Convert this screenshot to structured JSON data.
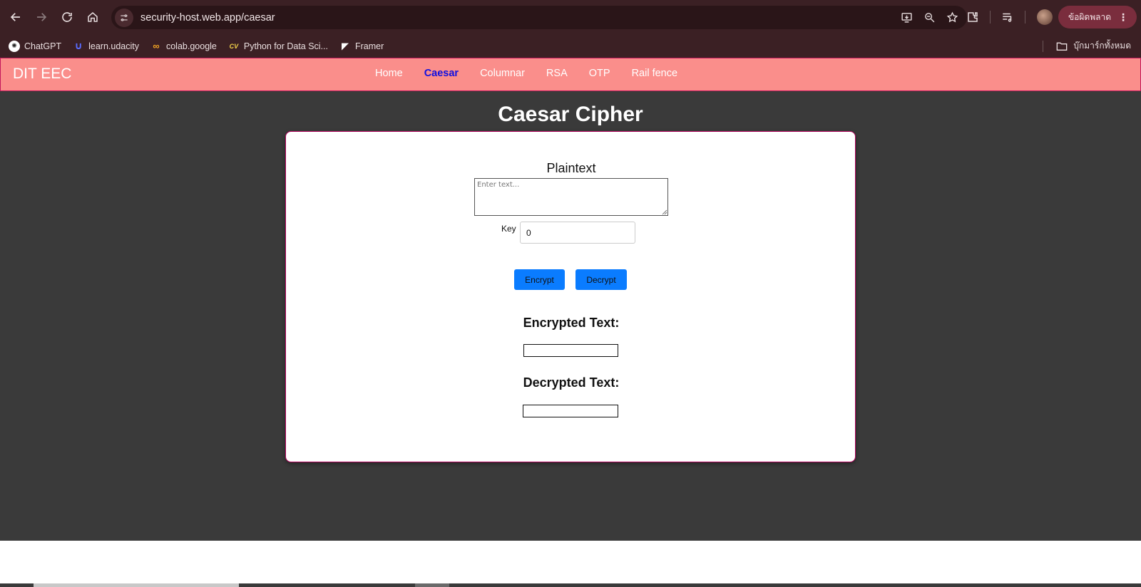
{
  "browser": {
    "url": "security-host.web.app/caesar",
    "error_chip_label": "ข้อผิดพลาด",
    "bookmarks": [
      {
        "label": "ChatGPT",
        "icon": "chatgpt-icon"
      },
      {
        "label": "learn.udacity",
        "icon": "udacity-icon"
      },
      {
        "label": "colab.google",
        "icon": "colab-icon"
      },
      {
        "label": "Python for Data Sci...",
        "icon": "cv-icon",
        "icon_text": "CV"
      },
      {
        "label": "Framer",
        "icon": "framer-icon"
      }
    ],
    "all_bookmarks_label": "บุ๊กมาร์กทั้งหมด"
  },
  "site": {
    "brand": "DIT EEC",
    "nav": [
      {
        "label": "Home",
        "active": false
      },
      {
        "label": "Caesar",
        "active": true
      },
      {
        "label": "Columnar",
        "active": false
      },
      {
        "label": "RSA",
        "active": false
      },
      {
        "label": "OTP",
        "active": false
      },
      {
        "label": "Rail fence",
        "active": false
      }
    ]
  },
  "page": {
    "title": "Caesar Cipher",
    "plaintext_label": "Plaintext",
    "plaintext_placeholder": "Enter text...",
    "plaintext_value": "",
    "key_label": "Key",
    "key_value": "0",
    "encrypt_label": "Encrypt",
    "decrypt_label": "Decrypt",
    "encrypted_title": "Encrypted Text:",
    "encrypted_value": "",
    "decrypted_title": "Decrypted Text:",
    "decrypted_value": ""
  },
  "colors": {
    "navbar_bg": "#fa8e8b",
    "active_nav": "#1010e0",
    "button_bg": "#0a7cff",
    "page_bg": "#3a3a3a",
    "chrome_bg": "#3b2024"
  }
}
